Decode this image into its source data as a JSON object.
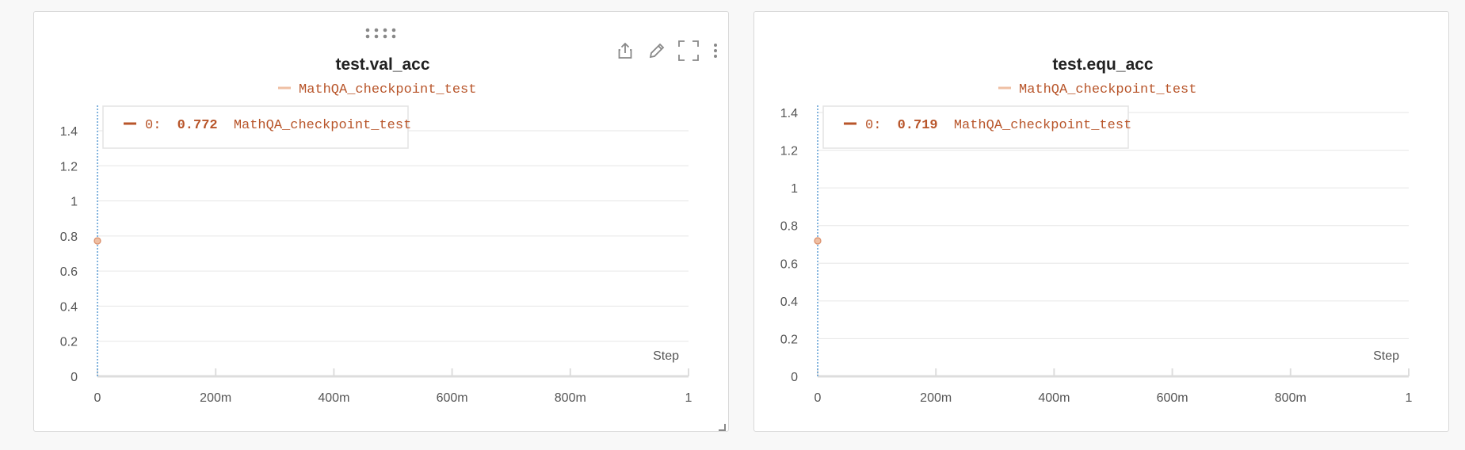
{
  "colors": {
    "series": "#b8552a",
    "series_light": "#efbfa3",
    "crosshair": "#5a9bd4",
    "grid": "#e6e6e6",
    "axis": "#dddddd",
    "tick_text": "#555555",
    "title_text": "#222222",
    "icon": "#888888"
  },
  "icons": {
    "drag": "drag-handle-icon",
    "share": "share-icon",
    "edit": "pencil-icon",
    "fullscreen": "fullscreen-icon",
    "more": "more-vertical-icon",
    "resize": "resize-corner-icon"
  },
  "chart_data": [
    {
      "type": "line",
      "title": "test.val_acc",
      "legend": [
        "MathQA_checkpoint_test"
      ],
      "xlabel": "Step",
      "ylabel": "",
      "xlim": [
        0,
        1
      ],
      "ylim": [
        0,
        1.4
      ],
      "x_ticks": [
        "0",
        "200m",
        "400m",
        "600m",
        "800m",
        "1"
      ],
      "x_tick_values": [
        0,
        0.2,
        0.4,
        0.6,
        0.8,
        1
      ],
      "y_ticks": [
        "0",
        "0.2",
        "0.4",
        "0.6",
        "0.8",
        "1",
        "1.2",
        "1.4"
      ],
      "y_tick_values": [
        0,
        0.2,
        0.4,
        0.6,
        0.8,
        1,
        1.2,
        1.4
      ],
      "grid": true,
      "series": [
        {
          "name": "MathQA_checkpoint_test",
          "x": [
            0
          ],
          "y": [
            0.772
          ]
        }
      ],
      "tooltip": {
        "index_label": "0:",
        "value": "0.772",
        "name": "MathQA_checkpoint_test"
      }
    },
    {
      "type": "line",
      "title": "test.equ_acc",
      "legend": [
        "MathQA_checkpoint_test"
      ],
      "xlabel": "Step",
      "ylabel": "",
      "xlim": [
        0,
        1
      ],
      "ylim": [
        0,
        1.4
      ],
      "x_ticks": [
        "0",
        "200m",
        "400m",
        "600m",
        "800m",
        "1"
      ],
      "x_tick_values": [
        0,
        0.2,
        0.4,
        0.6,
        0.8,
        1
      ],
      "y_ticks": [
        "0",
        "0.2",
        "0.4",
        "0.6",
        "0.8",
        "1",
        "1.2",
        "1.4"
      ],
      "y_tick_values": [
        0,
        0.2,
        0.4,
        0.6,
        0.8,
        1,
        1.2,
        1.4
      ],
      "grid": true,
      "series": [
        {
          "name": "MathQA_checkpoint_test",
          "x": [
            0
          ],
          "y": [
            0.719
          ]
        }
      ],
      "tooltip": {
        "index_label": "0:",
        "value": "0.719",
        "name": "MathQA_checkpoint_test"
      }
    }
  ]
}
